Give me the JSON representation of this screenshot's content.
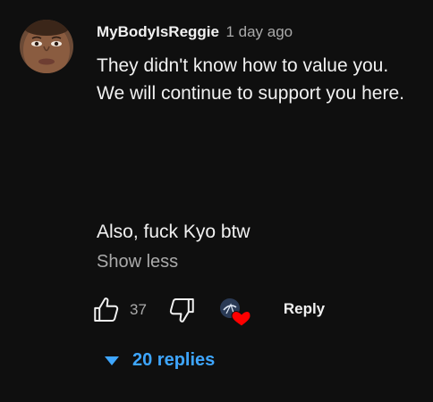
{
  "comment": {
    "author": "MyBodyIsReggie",
    "timestamp": "1 day ago",
    "text_lines": [
      "They didn't know how to value you.",
      "We will continue to support you here.",
      "Also, fuck Kyo btw"
    ],
    "show_less_label": "Show less"
  },
  "actions": {
    "like_count": "37",
    "reply_label": "Reply",
    "icons": [
      "thumb-up-icon",
      "thumb-down-icon",
      "creator-heart-icon",
      "caret-down-icon"
    ]
  },
  "replies": {
    "label": "20 replies"
  },
  "colors": {
    "background": "#0f0f0f",
    "text": "#f1f1f1",
    "secondary_text": "#aaaaaa",
    "link_blue": "#3ea6ff",
    "heart_red": "#ff0000"
  }
}
